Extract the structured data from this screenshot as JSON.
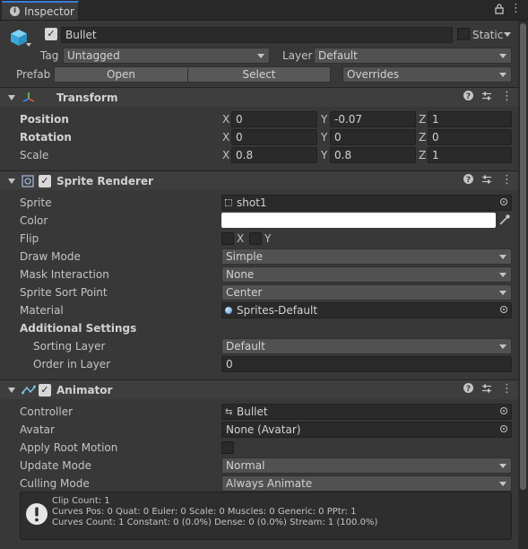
{
  "tab": {
    "title": "Inspector"
  },
  "header": {
    "object_name": "Bullet",
    "static_label": "Static",
    "tag_label": "Tag",
    "tag_value": "Untagged",
    "layer_label": "Layer",
    "layer_value": "Default",
    "prefab_label": "Prefab",
    "open_label": "Open",
    "select_label": "Select",
    "overrides_label": "Overrides"
  },
  "transform": {
    "title": "Transform",
    "rows": [
      {
        "label": "Position",
        "x": "0",
        "y": "-0.07",
        "z": "1"
      },
      {
        "label": "Rotation",
        "x": "0",
        "y": "0",
        "z": "0"
      },
      {
        "label": "Scale",
        "x": "0.8",
        "y": "0.8",
        "z": "1"
      }
    ],
    "axis_x": "X",
    "axis_y": "Y",
    "axis_z": "Z"
  },
  "sprite_renderer": {
    "title": "Sprite Renderer",
    "sprite_label": "Sprite",
    "sprite_value": "shot1",
    "color_label": "Color",
    "color_value": "#ffffff",
    "flip_label": "Flip",
    "flip_x": "X",
    "flip_y": "Y",
    "draw_mode_label": "Draw Mode",
    "draw_mode_value": "Simple",
    "mask_label": "Mask Interaction",
    "mask_value": "None",
    "sort_point_label": "Sprite Sort Point",
    "sort_point_value": "Center",
    "material_label": "Material",
    "material_value": "Sprites-Default",
    "additional_label": "Additional Settings",
    "sorting_layer_label": "Sorting Layer",
    "sorting_layer_value": "Default",
    "order_label": "Order in Layer",
    "order_value": "0"
  },
  "animator": {
    "title": "Animator",
    "controller_label": "Controller",
    "controller_value": "Bullet",
    "avatar_label": "Avatar",
    "avatar_value": "None (Avatar)",
    "root_motion_label": "Apply Root Motion",
    "update_mode_label": "Update Mode",
    "update_mode_value": "Normal",
    "culling_label": "Culling Mode",
    "culling_value": "Always Animate",
    "info_lines": [
      "Clip Count: 1",
      "Curves Pos: 0 Quat: 0 Euler: 0 Scale: 0 Muscles: 0 Generic: 0 PPtr: 1",
      "Curves Count: 1 Constant: 0 (0.0%) Dense: 0 (0.0%) Stream: 1 (100.0%)"
    ]
  },
  "colors": {
    "accent": "#3a7bd5",
    "background": "#383838",
    "field": "#2a2a2a"
  }
}
